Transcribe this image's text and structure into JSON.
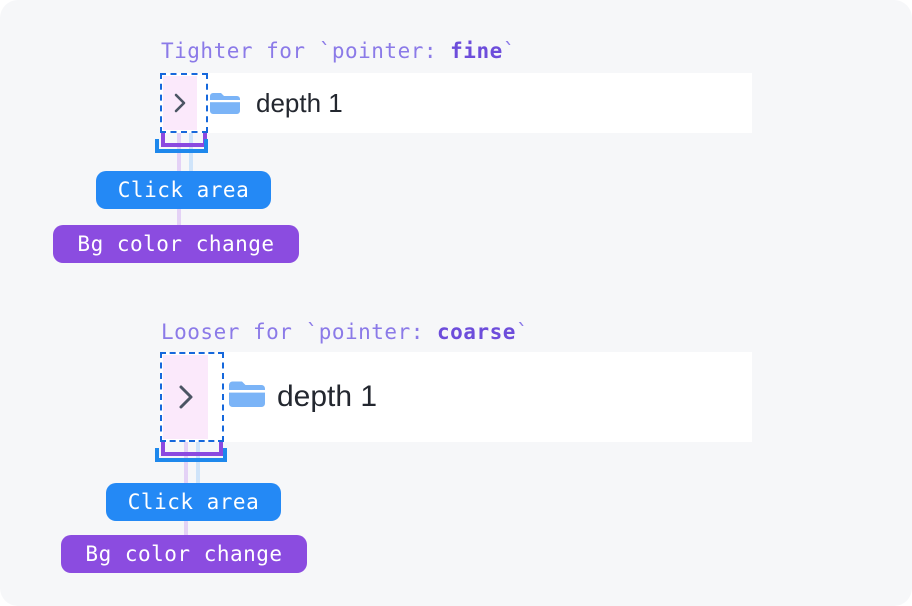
{
  "page": {
    "background_color": "#f6f7f9",
    "corner_radius": "18px"
  },
  "sections": [
    {
      "id": "fine",
      "heading_prefix": "Tighter for `pointer: ",
      "heading_keyword": "fine",
      "heading_suffix": "`",
      "row": {
        "chevron_icon": "chevron-right-icon",
        "folder_icon": "folder-icon",
        "label": "depth 1",
        "background_color": "#ffffff"
      },
      "annotations": {
        "click_area": {
          "label": "Click area",
          "color": "#2489f5",
          "outline_color": "#1668dc"
        },
        "bg_color_change": {
          "label": "Bg color change",
          "color": "#8b4ce0",
          "patch_color": "#fbe9fb"
        }
      }
    },
    {
      "id": "coarse",
      "heading_prefix": "Looser for `pointer: ",
      "heading_keyword": "coarse",
      "heading_suffix": "`",
      "row": {
        "chevron_icon": "chevron-right-icon",
        "folder_icon": "folder-icon",
        "label": "depth 1",
        "background_color": "#ffffff"
      },
      "annotations": {
        "click_area": {
          "label": "Click area",
          "color": "#2489f5",
          "outline_color": "#1668dc"
        },
        "bg_color_change": {
          "label": "Bg color change",
          "color": "#8b4ce0",
          "patch_color": "#fbe9fb"
        }
      }
    }
  ]
}
